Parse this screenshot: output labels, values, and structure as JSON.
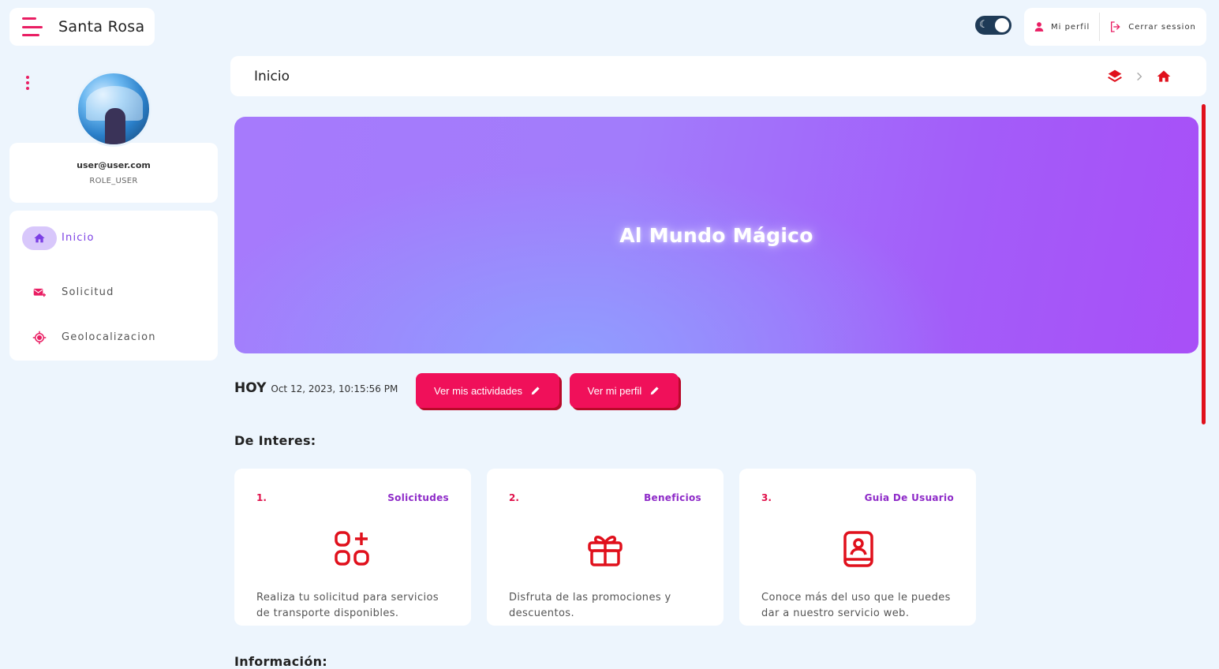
{
  "app": {
    "title": "Santa Rosa"
  },
  "topbar": {
    "profile_label": "Mi perfil",
    "logout_label": "Cerrar session"
  },
  "user": {
    "email": "user@user.com",
    "role": "ROLE_USER"
  },
  "sidebar": {
    "items": [
      {
        "label": "Inicio",
        "icon": "home-icon",
        "active": true
      },
      {
        "label": "Solicitud",
        "icon": "mail-send-icon",
        "active": false
      },
      {
        "label": "Geolocalizacion",
        "icon": "location-target-icon",
        "active": false
      }
    ]
  },
  "header": {
    "title": "Inicio"
  },
  "banner": {
    "title": "Al Mundo Mágico"
  },
  "today": {
    "label": "HOY",
    "datetime": "Oct 12, 2023, 10:15:56 PM"
  },
  "buttons": {
    "activities": "Ver mis actividades",
    "profile": "Ver mi perfil"
  },
  "sections": {
    "interest": "De Interes:",
    "info": "Información:"
  },
  "cards": [
    {
      "number": "1.",
      "title": "Solicitudes",
      "icon": "apps-add-icon",
      "description": "Realiza tu solicitud para servicios de transporte disponibles."
    },
    {
      "number": "2.",
      "title": "Beneficios",
      "icon": "gift-icon",
      "description": "Disfruta de las promociones y descuentos."
    },
    {
      "number": "3.",
      "title": "Guia De Usuario",
      "icon": "user-guide-book-icon",
      "description": "Conoce más del uso que le puedes dar a nuestro servicio web."
    }
  ],
  "colors": {
    "accent": "#e91e63",
    "button": "#f0105a",
    "active_nav_bg": "#d8c7fb",
    "active_nav_text": "#7b3fe4",
    "card_title": "#8e2ac8",
    "icon_red": "#e0101c",
    "background": "#edf5fd"
  }
}
